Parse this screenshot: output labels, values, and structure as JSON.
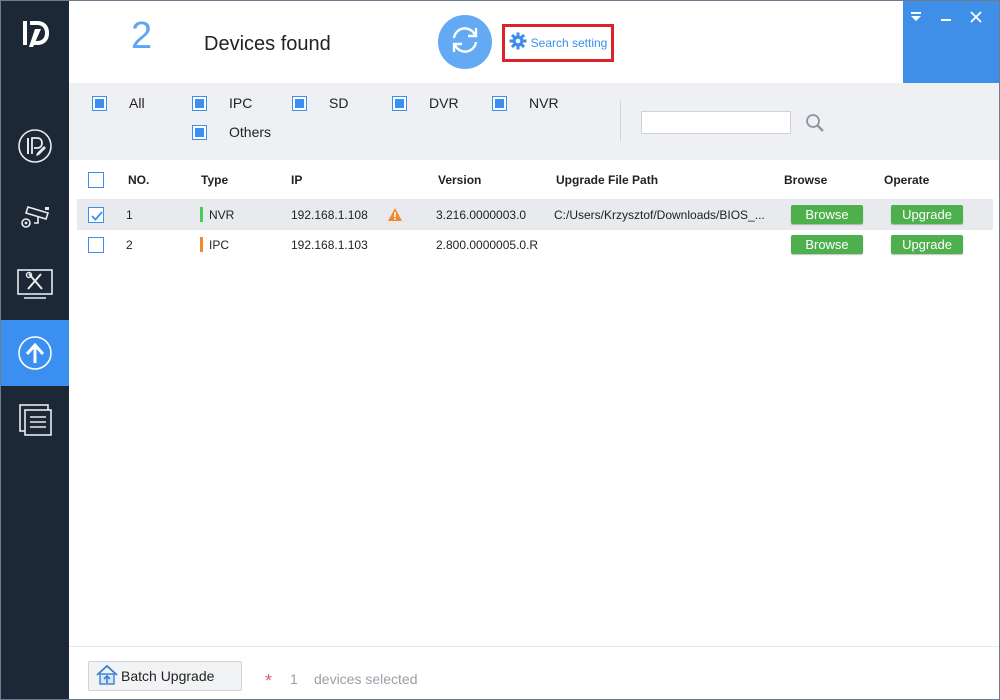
{
  "header": {
    "device_count": "2",
    "found_label": "Devices found",
    "search_setting_label": "Search setting"
  },
  "filters": [
    {
      "label": "All",
      "checked": true
    },
    {
      "label": "IPC",
      "checked": true
    },
    {
      "label": "SD",
      "checked": true
    },
    {
      "label": "DVR",
      "checked": true
    },
    {
      "label": "NVR",
      "checked": true
    },
    {
      "label": "Others",
      "checked": true
    }
  ],
  "search": {
    "value": "",
    "placeholder": ""
  },
  "table": {
    "columns": [
      "NO.",
      "Type",
      "IP",
      "Version",
      "Upgrade File Path",
      "Browse",
      "Operate"
    ],
    "rows": [
      {
        "checked": true,
        "no": "1",
        "type": "NVR",
        "type_color": "#3fcf5a",
        "ip": "192.168.1.108",
        "warning": true,
        "version": "3.216.0000003.0",
        "path": "C:/Users/Krzysztof/Downloads/BIOS_...",
        "browse_label": "Browse",
        "operate_label": "Upgrade"
      },
      {
        "checked": false,
        "no": "2",
        "type": "IPC",
        "type_color": "#f0892b",
        "ip": "192.168.1.103",
        "warning": false,
        "version": "2.800.0000005.0.R",
        "path": "",
        "browse_label": "Browse",
        "operate_label": "Upgrade"
      }
    ]
  },
  "footer": {
    "batch_label": "Batch Upgrade",
    "asterisk": "*",
    "selected_count": "1",
    "selected_label": "devices selected"
  },
  "colors": {
    "accent": "#3b8ff0",
    "sidebar": "#1c2836",
    "green": "#4db04d",
    "highlight_box": "#d9242c"
  },
  "icons": {
    "logo": "brand-logo-icon",
    "nav": [
      "ip-config-icon",
      "camera-icon",
      "tools-icon",
      "upgrade-icon",
      "info-list-icon"
    ],
    "refresh": "refresh-icon",
    "search_setting": "gear-icon",
    "window": [
      "menu-dropdown-icon",
      "minimize-icon",
      "close-icon"
    ],
    "search": "search-icon",
    "warning": "warning-icon",
    "batch": "house-upload-icon"
  }
}
